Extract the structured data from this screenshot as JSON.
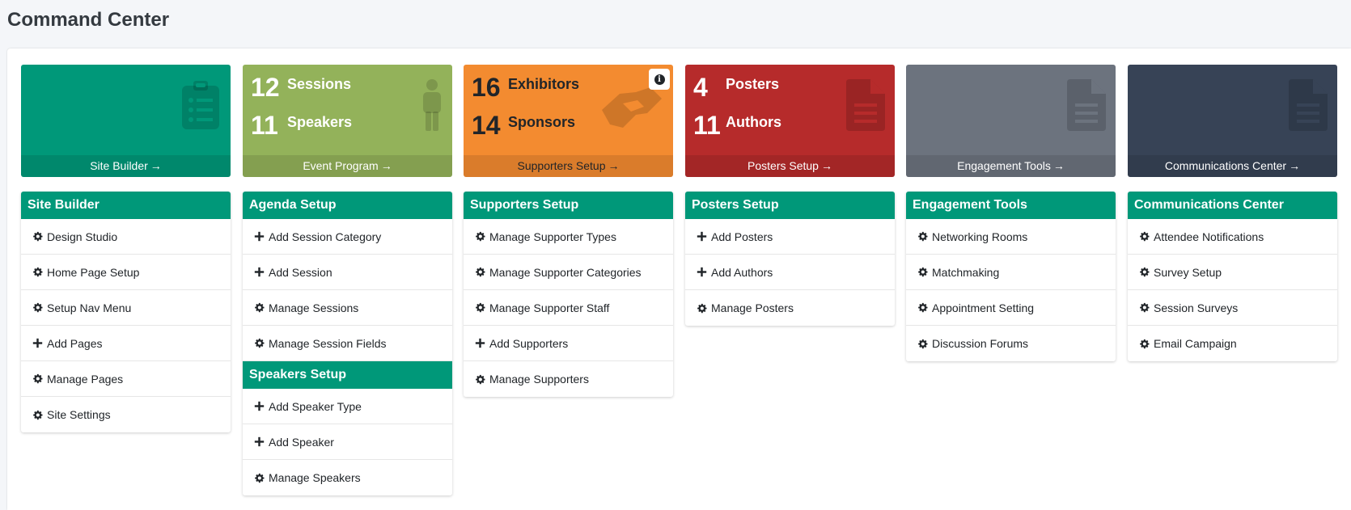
{
  "page_title": "Command Center",
  "colors": {
    "teal": "#009879",
    "green": "#93b25a",
    "orange": "#f38b30",
    "red": "#b62b2b",
    "gray": "#6c737e",
    "navy": "#374356"
  },
  "tiles": [
    {
      "footer": "Site Builder",
      "arrow": "→",
      "icon": "clipboard-list-icon"
    },
    {
      "footer": "Event Program",
      "arrow": "→",
      "icon": "user-icon",
      "stats": [
        {
          "num": "12",
          "label": "Sessions"
        },
        {
          "num": "11",
          "label": "Speakers"
        }
      ]
    },
    {
      "footer": "Supporters Setup",
      "arrow": "→",
      "icon": "handshake-icon",
      "stats": [
        {
          "num": "16",
          "label": "Exhibitors"
        },
        {
          "num": "14",
          "label": "Sponsors"
        }
      ]
    },
    {
      "footer": "Posters Setup",
      "arrow": "→",
      "icon": "file-icon",
      "stats": [
        {
          "num": "4",
          "label": "Posters"
        },
        {
          "num": "11",
          "label": "Authors"
        }
      ]
    },
    {
      "footer": "Engagement Tools",
      "arrow": "→",
      "icon": "file-icon"
    },
    {
      "footer": "Communications Center",
      "arrow": "→",
      "icon": "file-icon"
    }
  ],
  "cards": {
    "site_builder": {
      "title": "Site Builder",
      "items": [
        "Design Studio",
        "Home Page Setup",
        "Setup Nav Menu",
        "Add Pages",
        "Manage Pages",
        "Site Settings"
      ]
    },
    "agenda": {
      "title": "Agenda Setup",
      "items": [
        "Add Session Category",
        "Add Session",
        "Manage Sessions",
        "Manage Session Fields"
      ]
    },
    "speakers": {
      "title": "Speakers Setup",
      "items": [
        "Add Speaker Type",
        "Add Speaker",
        "Manage Speakers"
      ]
    },
    "supporters": {
      "title": "Supporters Setup",
      "items": [
        "Manage Supporter Types",
        "Manage Supporter Categories",
        "Manage Supporter Staff",
        "Add Supporters",
        "Manage Supporters"
      ]
    },
    "posters": {
      "title": "Posters Setup",
      "items": [
        "Add Posters",
        "Add Authors",
        "Manage Posters"
      ]
    },
    "engagement": {
      "title": "Engagement Tools",
      "items": [
        "Networking Rooms",
        "Matchmaking",
        "Appointment Setting",
        "Discussion Forums"
      ]
    },
    "communications": {
      "title": "Communications Center",
      "items": [
        "Attendee Notifications",
        "Survey Setup",
        "Session Surveys",
        "Email Campaign"
      ]
    }
  }
}
